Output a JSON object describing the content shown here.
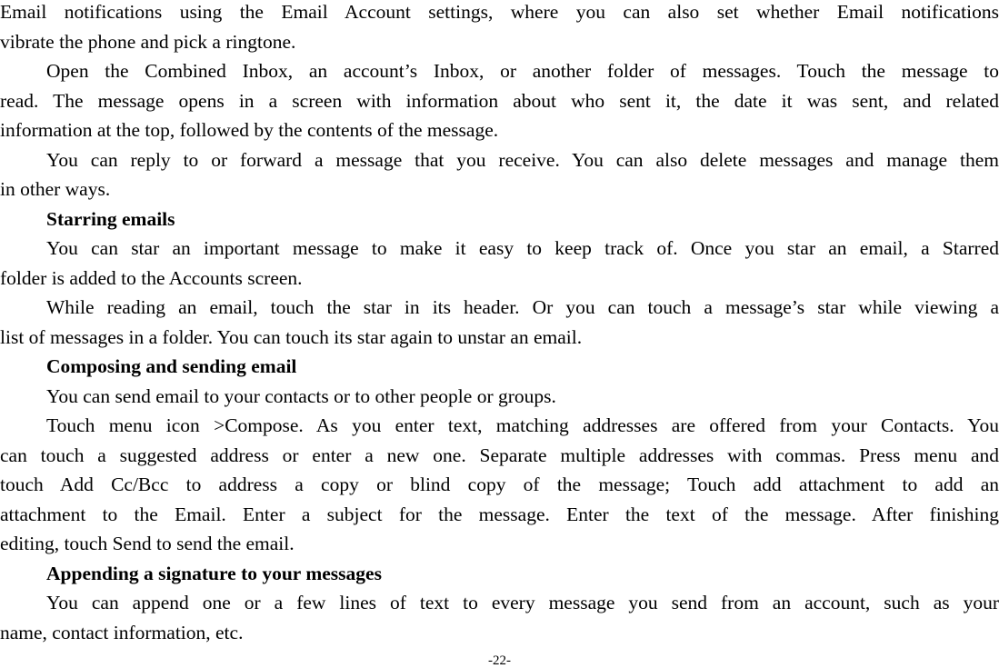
{
  "document": {
    "lines": [
      {
        "text": "Email notifications using the Email Account settings, where you can also set whether Email notifications",
        "type": "body",
        "justify": true,
        "indent": false
      },
      {
        "text": "vibrate the phone and pick a ringtone.",
        "type": "body",
        "justify": false,
        "indent": false
      },
      {
        "text": "Open the Combined Inbox, an account’s Inbox, or another folder of messages. Touch the message to",
        "type": "body",
        "justify": true,
        "indent": true
      },
      {
        "text": "read. The message opens in a screen with information about who sent it, the date it was sent, and related",
        "type": "body",
        "justify": true,
        "indent": false
      },
      {
        "text": "information at the top, followed by the contents of the message.",
        "type": "body",
        "justify": false,
        "indent": false
      },
      {
        "text": "You can reply to or forward a message that you receive. You can also delete messages and manage them",
        "type": "body",
        "justify": true,
        "indent": true
      },
      {
        "text": "in other ways.",
        "type": "body",
        "justify": false,
        "indent": false
      },
      {
        "text": "Starring emails",
        "type": "heading",
        "justify": false,
        "indent": true
      },
      {
        "text": "You can star an important message to make it easy to keep track of. Once you star an email, a Starred",
        "type": "body",
        "justify": true,
        "indent": true
      },
      {
        "text": "folder is added to the Accounts screen.",
        "type": "body",
        "justify": false,
        "indent": false
      },
      {
        "text": "While reading an email, touch the star in its header. Or you can touch a message’s star while viewing a",
        "type": "body",
        "justify": true,
        "indent": true
      },
      {
        "text": "list of messages in a folder. You can touch its star again to unstar an email.",
        "type": "body",
        "justify": false,
        "indent": false
      },
      {
        "text": "Composing and sending email",
        "type": "heading",
        "justify": false,
        "indent": true
      },
      {
        "text": "You can send email to your contacts or to other people or groups.",
        "type": "body",
        "justify": false,
        "indent": true
      },
      {
        "text": "Touch menu icon >Compose. As you enter text, matching addresses are offered from your Contacts. You",
        "type": "body",
        "justify": true,
        "indent": true
      },
      {
        "text": "can touch a suggested address or enter a new one. Separate multiple addresses with commas. Press menu and",
        "type": "body",
        "justify": true,
        "indent": false
      },
      {
        "text": "touch Add Cc/Bcc to address a copy or blind copy of the message; Touch add attachment to add an",
        "type": "body",
        "justify": true,
        "indent": false
      },
      {
        "text": "attachment to the Email. Enter a subject for the message. Enter the text of the message. After finishing",
        "type": "body",
        "justify": true,
        "indent": false
      },
      {
        "text": "editing, touch Send to send the email.",
        "type": "body",
        "justify": false,
        "indent": false
      },
      {
        "text": "Appending a signature to your messages",
        "type": "heading",
        "justify": false,
        "indent": true
      },
      {
        "text": "You can append one or a few lines of text to every message you send from an account, such as your",
        "type": "body",
        "justify": true,
        "indent": true
      },
      {
        "text": "name, contact information, etc.",
        "type": "body",
        "justify": false,
        "indent": false
      }
    ],
    "page_number": "-22-"
  }
}
